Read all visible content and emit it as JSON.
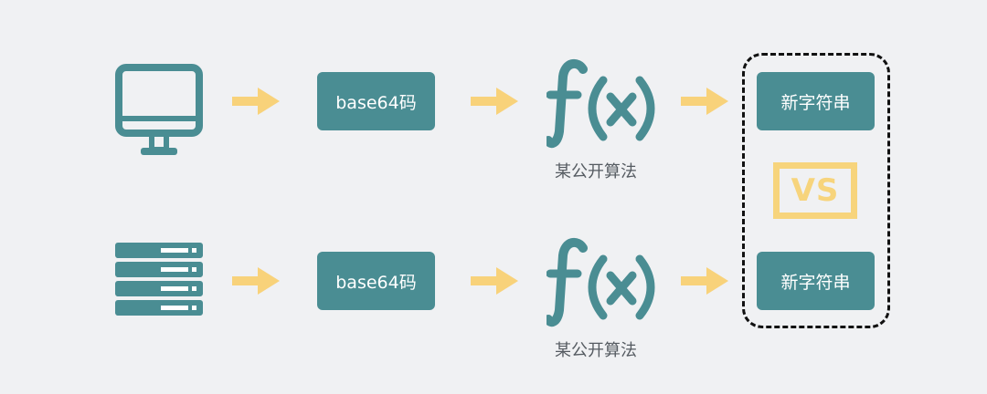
{
  "colors": {
    "background": "#f0f1f3",
    "teal": "#4a8d93",
    "arrow_yellow": "#f8d27a",
    "vs_yellow": "#f7d47c",
    "label_gray": "#555b61"
  },
  "rows": [
    {
      "source_icon": "monitor-icon",
      "encode_box": "base64码",
      "function_icon": "function-fx-icon",
      "function_label": "某公开算法",
      "result_box": "新字符串"
    },
    {
      "source_icon": "server-icon",
      "encode_box": "base64码",
      "function_icon": "function-fx-icon",
      "function_label": "某公开算法",
      "result_box": "新字符串"
    }
  ],
  "comparison": {
    "label": "VS"
  }
}
